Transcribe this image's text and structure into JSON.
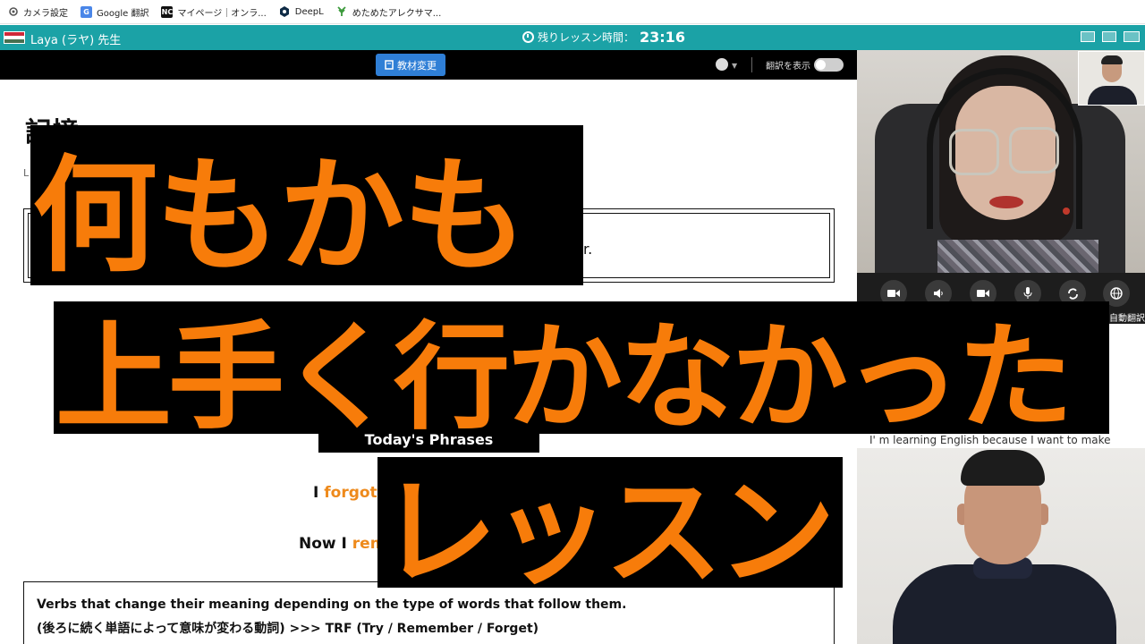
{
  "bookmarks": [
    {
      "label": "カメラ設定",
      "icon": "gear-icon"
    },
    {
      "label": "Google 翻訳",
      "icon": "google-translate-icon"
    },
    {
      "label": "マイページ｜オンラ...",
      "icon": "nc-icon",
      "icon_text": "NC"
    },
    {
      "label": "DeepL",
      "icon": "deepl-icon"
    },
    {
      "label": "めためたアレクサマ...",
      "icon": "leaf-icon"
    }
  ],
  "header": {
    "teacher": "Laya (ラヤ) 先生",
    "timer_label": "残りレッスン時間：",
    "timer_value": "23:16",
    "accent": "#1ba2a6"
  },
  "toolbar": {
    "material_button": "教材変更",
    "translate_label": "翻訳を表示",
    "translate_on": false
  },
  "material": {
    "title": "記憶",
    "small_text": "L",
    "box_text": "r.",
    "phrases_heading": "Today's Phrases",
    "line1_prefix": "I ",
    "line1_highlight": "forgot",
    "line2_prefix": "Now I ",
    "line2_highlight": "rem",
    "verbs_line1": "Verbs that change their meaning depending on the type of words that follow them.",
    "verbs_line2": "(後ろに続く単語によって意味が変わる動詞) >>> TRF (Try / Remember / Forget)",
    "highlight_color": "#ee8a1c"
  },
  "video": {
    "controls": [
      "camera-icon",
      "speaker-icon",
      "camera-icon",
      "mic-icon",
      "refresh-icon",
      "globe-icon"
    ],
    "auto_translate_label": "自動翻訳",
    "caption": "I' m learning English because I want to make"
  },
  "overlay": {
    "line1": "何もかも",
    "line2": "上手く行かなかった",
    "line3": "レッスン",
    "text_color": "#f77c0a"
  }
}
